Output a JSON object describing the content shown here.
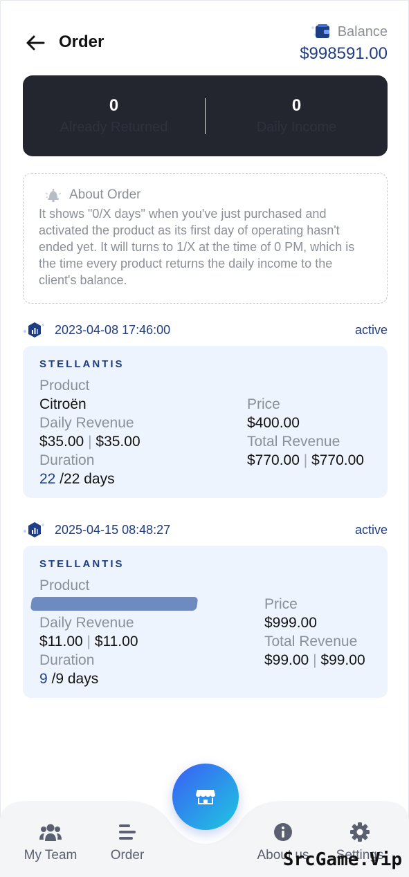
{
  "header": {
    "title": "Order",
    "balance_label": "Balance",
    "balance_amount": "$998591.00"
  },
  "stats": {
    "returned_value": "0",
    "returned_label": "Already Returned",
    "income_value": "0",
    "income_label": "Daily Income"
  },
  "about": {
    "title": "About Order",
    "text": "It shows \"0/X days\" when you've just purchased and activated the product as its first day of operating hasn't ended yet. It will turns to 1/X at the time of 0 PM, which is the time every product returns the daily income to the client's balance."
  },
  "orders": [
    {
      "date": "2023-04-08 17:46:00",
      "status": "active",
      "brand": "STELLANTIS",
      "product_label": "Product",
      "product_name": "Citroën",
      "price_label": "Price",
      "price": "$400.00",
      "daily_label": "Daily Revenue",
      "daily_a": "$35.00",
      "daily_b": "$35.00",
      "total_label": "Total Revenue",
      "total_a": "$770.00",
      "total_b": "$770.00",
      "duration_label": "Duration",
      "duration_done": "22",
      "duration_total": "/22 days"
    },
    {
      "date": "2025-04-15 08:48:27",
      "status": "active",
      "brand": "STELLANTIS",
      "product_label": "Product",
      "product_name": "",
      "price_label": "Price",
      "price": "$999.00",
      "daily_label": "Daily Revenue",
      "daily_a": "$11.00",
      "daily_b": "$11.00",
      "total_label": "Total Revenue",
      "total_a": "$99.00",
      "total_b": "$99.00",
      "duration_label": "Duration",
      "duration_done": "9",
      "duration_total": "/9 days"
    }
  ],
  "separator": "|",
  "nav": {
    "team": "My Team",
    "order": "Order",
    "about": "About us",
    "settings": "Settings"
  },
  "watermark": "SrcGame.Vip",
  "colors": {
    "accent": "#1f3d82",
    "card_bg": "#eef4fd",
    "stats_bg": "#23262f"
  },
  "icons": [
    "back-arrow-icon",
    "wallet-icon",
    "bell-icon",
    "chart-badge-icon",
    "team-icon",
    "order-list-icon",
    "store-icon",
    "info-icon",
    "gear-icon"
  ]
}
